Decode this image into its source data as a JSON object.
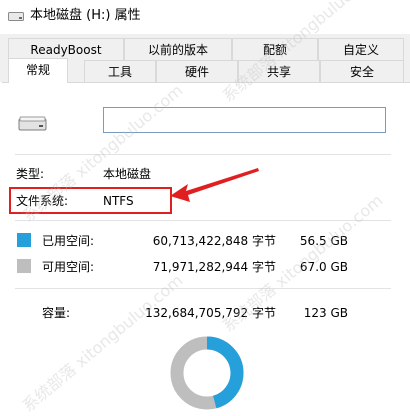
{
  "window": {
    "title": "本地磁盘 (H:) 属性"
  },
  "tabs_row1": [
    "ReadyBoost",
    "以前的版本",
    "配额",
    "自定义"
  ],
  "tabs_row2": [
    "常规",
    "工具",
    "硬件",
    "共享",
    "安全"
  ],
  "active_tab": "常规",
  "volume_name": {
    "value": "",
    "placeholder": ""
  },
  "type": {
    "label": "类型:",
    "value": "本地磁盘"
  },
  "filesystem": {
    "label": "文件系统:",
    "value": "NTFS"
  },
  "used": {
    "label": "已用空间:",
    "bytes": "60,713,422,848 字节",
    "size": "56.5 GB",
    "color": "#26a0da"
  },
  "free": {
    "label": "可用空间:",
    "bytes": "71,971,282,944 字节",
    "size": "67.0 GB",
    "color": "#bebebe"
  },
  "capacity": {
    "label": "容量:",
    "bytes": "132,684,705,792 字节",
    "size": "123 GB"
  },
  "usage_fraction": 0.4576,
  "annotation": {
    "highlight_color": "#e02020"
  },
  "icons": [
    "drive-icon",
    "drive-large-icon",
    "arrow-annotation-icon"
  ]
}
